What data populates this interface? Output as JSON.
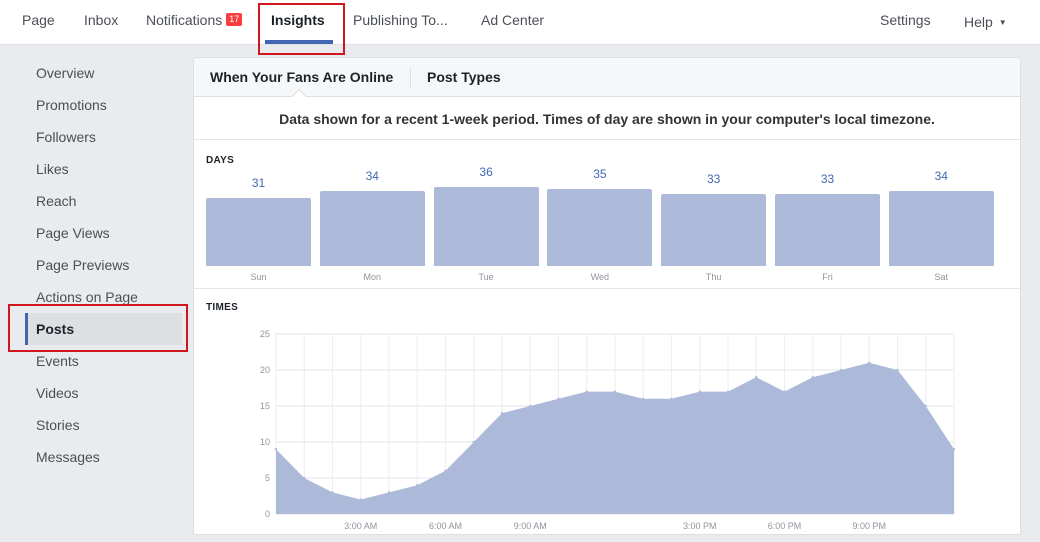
{
  "topnav": {
    "items": [
      {
        "label": "Page"
      },
      {
        "label": "Inbox"
      },
      {
        "label": "Notifications",
        "badge": "17"
      },
      {
        "label": "Insights"
      },
      {
        "label": "Publishing To..."
      },
      {
        "label": "Ad Center"
      }
    ],
    "settings": "Settings",
    "help": "Help"
  },
  "sidebar": {
    "items": [
      {
        "label": "Overview"
      },
      {
        "label": "Promotions"
      },
      {
        "label": "Followers"
      },
      {
        "label": "Likes"
      },
      {
        "label": "Reach"
      },
      {
        "label": "Page Views"
      },
      {
        "label": "Page Previews"
      },
      {
        "label": "Actions on Page"
      },
      {
        "label": "Posts"
      },
      {
        "label": "Events"
      },
      {
        "label": "Videos"
      },
      {
        "label": "Stories"
      },
      {
        "label": "Messages"
      }
    ],
    "active": "Posts"
  },
  "panel": {
    "tabs": [
      {
        "label": "When Your Fans Are Online"
      },
      {
        "label": "Post Types"
      }
    ],
    "description": "Data shown for a recent 1-week period. Times of day are shown in your computer's local timezone.",
    "days_label": "DAYS",
    "times_label": "TIMES"
  },
  "colors": {
    "accent": "#4267b2",
    "bar_fill": "#adb9d8",
    "highlight_box": "#d0161e",
    "badge": "#fa3e3e"
  },
  "chart_data": [
    {
      "type": "bar",
      "title": "DAYS",
      "categories": [
        "Sun",
        "Mon",
        "Tue",
        "Wed",
        "Thu",
        "Fri",
        "Sat"
      ],
      "values": [
        31,
        34,
        36,
        35,
        33,
        33,
        34
      ]
    },
    {
      "type": "area",
      "title": "TIMES",
      "x": [
        0,
        1,
        2,
        3,
        4,
        5,
        6,
        7,
        8,
        9,
        10,
        11,
        12,
        13,
        14,
        15,
        16,
        17,
        18,
        19,
        20,
        21,
        22,
        23,
        24
      ],
      "values": [
        9,
        5,
        3,
        2,
        3,
        4,
        6,
        10,
        14,
        15,
        16,
        17,
        17,
        16,
        16,
        17,
        17,
        19,
        17,
        19,
        20,
        21,
        20,
        15,
        9
      ],
      "xticks": [
        {
          "x": 3,
          "label": "3:00 AM"
        },
        {
          "x": 6,
          "label": "6:00 AM"
        },
        {
          "x": 9,
          "label": "9:00 AM"
        },
        {
          "x": 15,
          "label": "3:00 PM"
        },
        {
          "x": 18,
          "label": "6:00 PM"
        },
        {
          "x": 21,
          "label": "9:00 PM"
        }
      ],
      "yticks": [
        0,
        5,
        10,
        15,
        20,
        25
      ],
      "ylim": [
        0,
        25
      ],
      "xlim": [
        0,
        24
      ],
      "grid": true
    }
  ]
}
